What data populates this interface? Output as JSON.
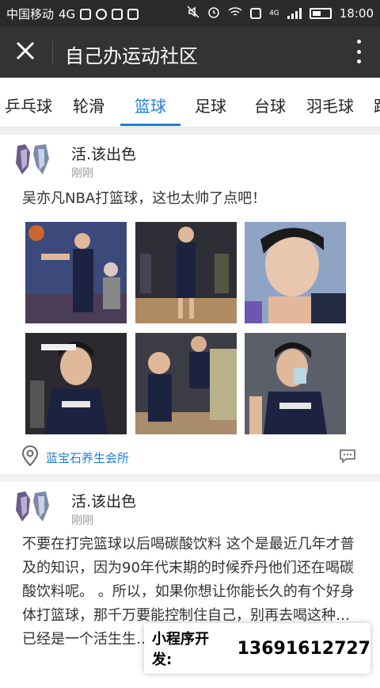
{
  "status_bar": {
    "carrier": "中国移动",
    "network": "4G",
    "time": "18:00",
    "net_tag": "4G"
  },
  "header": {
    "title": "自己办运动社区",
    "close_icon": "close-icon",
    "more_icon": "more-vertical-icon"
  },
  "tabs": [
    {
      "label": "乒乓球"
    },
    {
      "label": "轮滑"
    },
    {
      "label": "篮球",
      "active": true
    },
    {
      "label": "足球"
    },
    {
      "label": "台球"
    },
    {
      "label": "羽毛球"
    },
    {
      "label": "跑"
    }
  ],
  "colors": {
    "accent": "#1e7ed6",
    "header_bg": "#333333"
  },
  "posts": [
    {
      "author": "活.该出色",
      "time": "刚刚",
      "content": "吴亦凡NBA打篮球，这也太帅了点吧！",
      "photos": [
        "basketball-photo",
        "basketball-photo",
        "portrait-photo",
        "portrait-photo",
        "basketball-photo",
        "portrait-photo"
      ],
      "location": "蓝宝石养生会所"
    },
    {
      "author": "活.该出色",
      "time": "刚刚",
      "content": "不要在打完篮球以后喝碳酸饮料 这个是最近几年才普及的知识，因为90年代末期的时候乔丹他们还在喝碳酸饮料呢。 。所以，如果你想让你能长久的有个好身体打篮球，那千万要能控制住自己，别再去喝这种…已经是一个活生生…"
    }
  ],
  "banner": {
    "label": "小程序开发:",
    "phone": "13691612727"
  }
}
